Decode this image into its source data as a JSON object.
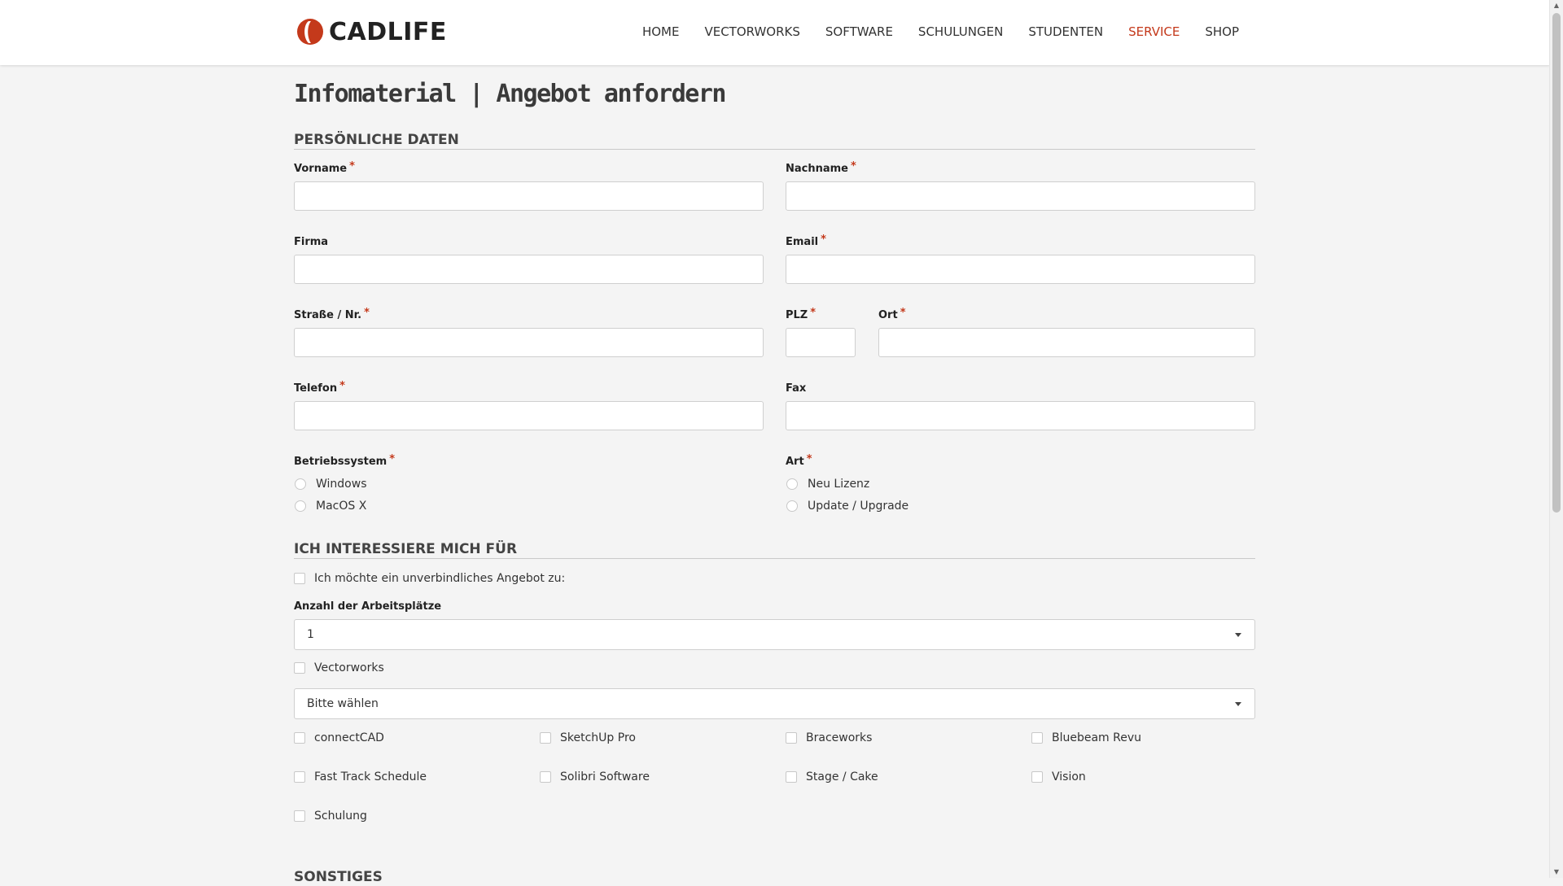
{
  "brand": {
    "name": "CADLIFE",
    "accent_color": "#c4391b"
  },
  "nav": {
    "items": [
      {
        "label": "HOME"
      },
      {
        "label": "VECTORWORKS"
      },
      {
        "label": "SOFTWARE"
      },
      {
        "label": "SCHULUNGEN"
      },
      {
        "label": "STUDENTEN"
      },
      {
        "label": "SERVICE",
        "active": true
      },
      {
        "label": "SHOP"
      }
    ]
  },
  "page": {
    "title": "Infomaterial | Angebot anfordern"
  },
  "personal": {
    "section_title": "PERSÖNLICHE DATEN",
    "required_mark": "*",
    "fields": {
      "vorname": {
        "label": "Vorname",
        "value": ""
      },
      "nachname": {
        "label": "Nachname",
        "value": ""
      },
      "firma": {
        "label": "Firma",
        "value": ""
      },
      "email": {
        "label": "Email",
        "value": ""
      },
      "strasse": {
        "label": "Straße / Nr.",
        "value": ""
      },
      "plz": {
        "label": "PLZ",
        "value": ""
      },
      "ort": {
        "label": "Ort",
        "value": ""
      },
      "telefon": {
        "label": "Telefon",
        "value": ""
      },
      "fax": {
        "label": "Fax",
        "value": ""
      }
    },
    "os": {
      "label": "Betriebssystem",
      "options": [
        "Windows",
        "MacOS X"
      ]
    },
    "art": {
      "label": "Art",
      "options": [
        "Neu Lizenz",
        "Update / Upgrade"
      ]
    }
  },
  "interest": {
    "section_title": "ICH INTERESSIERE MICH FÜR",
    "offer_checkbox": "Ich möchte ein unverbindliches Angebot zu:",
    "workplaces_label": "Anzahl der Arbeitsplätze",
    "workplaces_value": "1",
    "vectorworks_checkbox": "Vectorworks",
    "vectorworks_select": "Bitte wählen",
    "products": [
      [
        "connectCAD",
        "SketchUp Pro",
        "Braceworks",
        "Bluebeam Revu"
      ],
      [
        "Fast Track Schedule",
        "Solibri Software",
        "Stage / Cake",
        "Vision"
      ]
    ],
    "schulung": "Schulung"
  },
  "misc": {
    "section_title": "SONSTIGES"
  }
}
